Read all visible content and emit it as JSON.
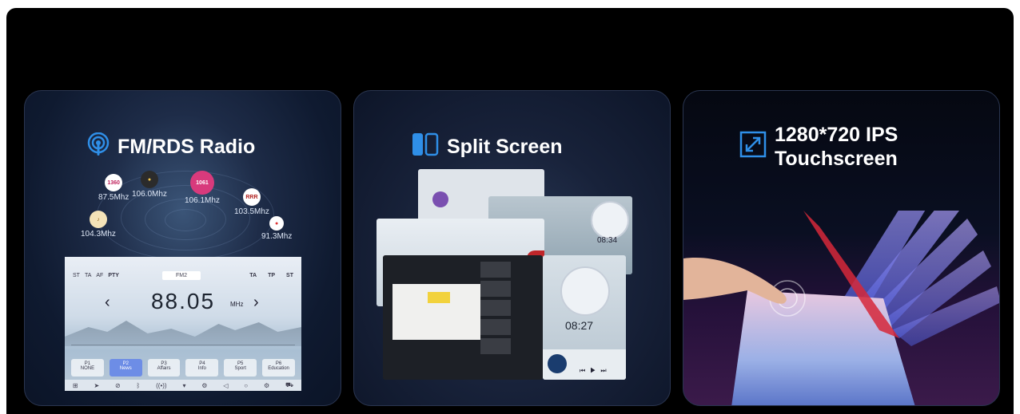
{
  "cards": {
    "radio": {
      "title": "FM/RDS Radio",
      "icon": "radio-broadcast-icon",
      "accent": "#2f8fe8",
      "stations": [
        {
          "freq": "87.5Mhz",
          "logo": "1360"
        },
        {
          "freq": "106.0Mhz",
          "logo": ""
        },
        {
          "freq": "106.1Mhz",
          "logo": "1061"
        },
        {
          "freq": "103.5Mhz",
          "logo": "RRR"
        },
        {
          "freq": "104.3Mhz",
          "logo": ""
        },
        {
          "freq": "91.3Mhz",
          "logo": ""
        }
      ],
      "screen": {
        "left_flags": [
          "ST",
          "TA",
          "AF",
          "PTY"
        ],
        "band": "FM2",
        "right_flags": [
          "TA",
          "TP",
          "ST"
        ],
        "frequency": "88.05",
        "unit": "MHz",
        "presets": [
          {
            "num": "P1",
            "label": "NONE"
          },
          {
            "num": "P2",
            "label": "News"
          },
          {
            "num": "P3",
            "label": "Affairs"
          },
          {
            "num": "P4",
            "label": "Info"
          },
          {
            "num": "P5",
            "label": "Sport"
          },
          {
            "num": "P6",
            "label": "Education"
          }
        ],
        "active_preset": 1
      }
    },
    "split": {
      "title": "Split Screen",
      "icon": "split-screen-icon",
      "accent": "#2f8fe8",
      "clock_time_back": "08:34",
      "clock_time_front": "08:27"
    },
    "touch": {
      "title_line1": "1280*720 IPS",
      "title_line2": "Touchscreen",
      "icon": "expand-diagonal-icon",
      "accent": "#2f8fe8"
    }
  }
}
